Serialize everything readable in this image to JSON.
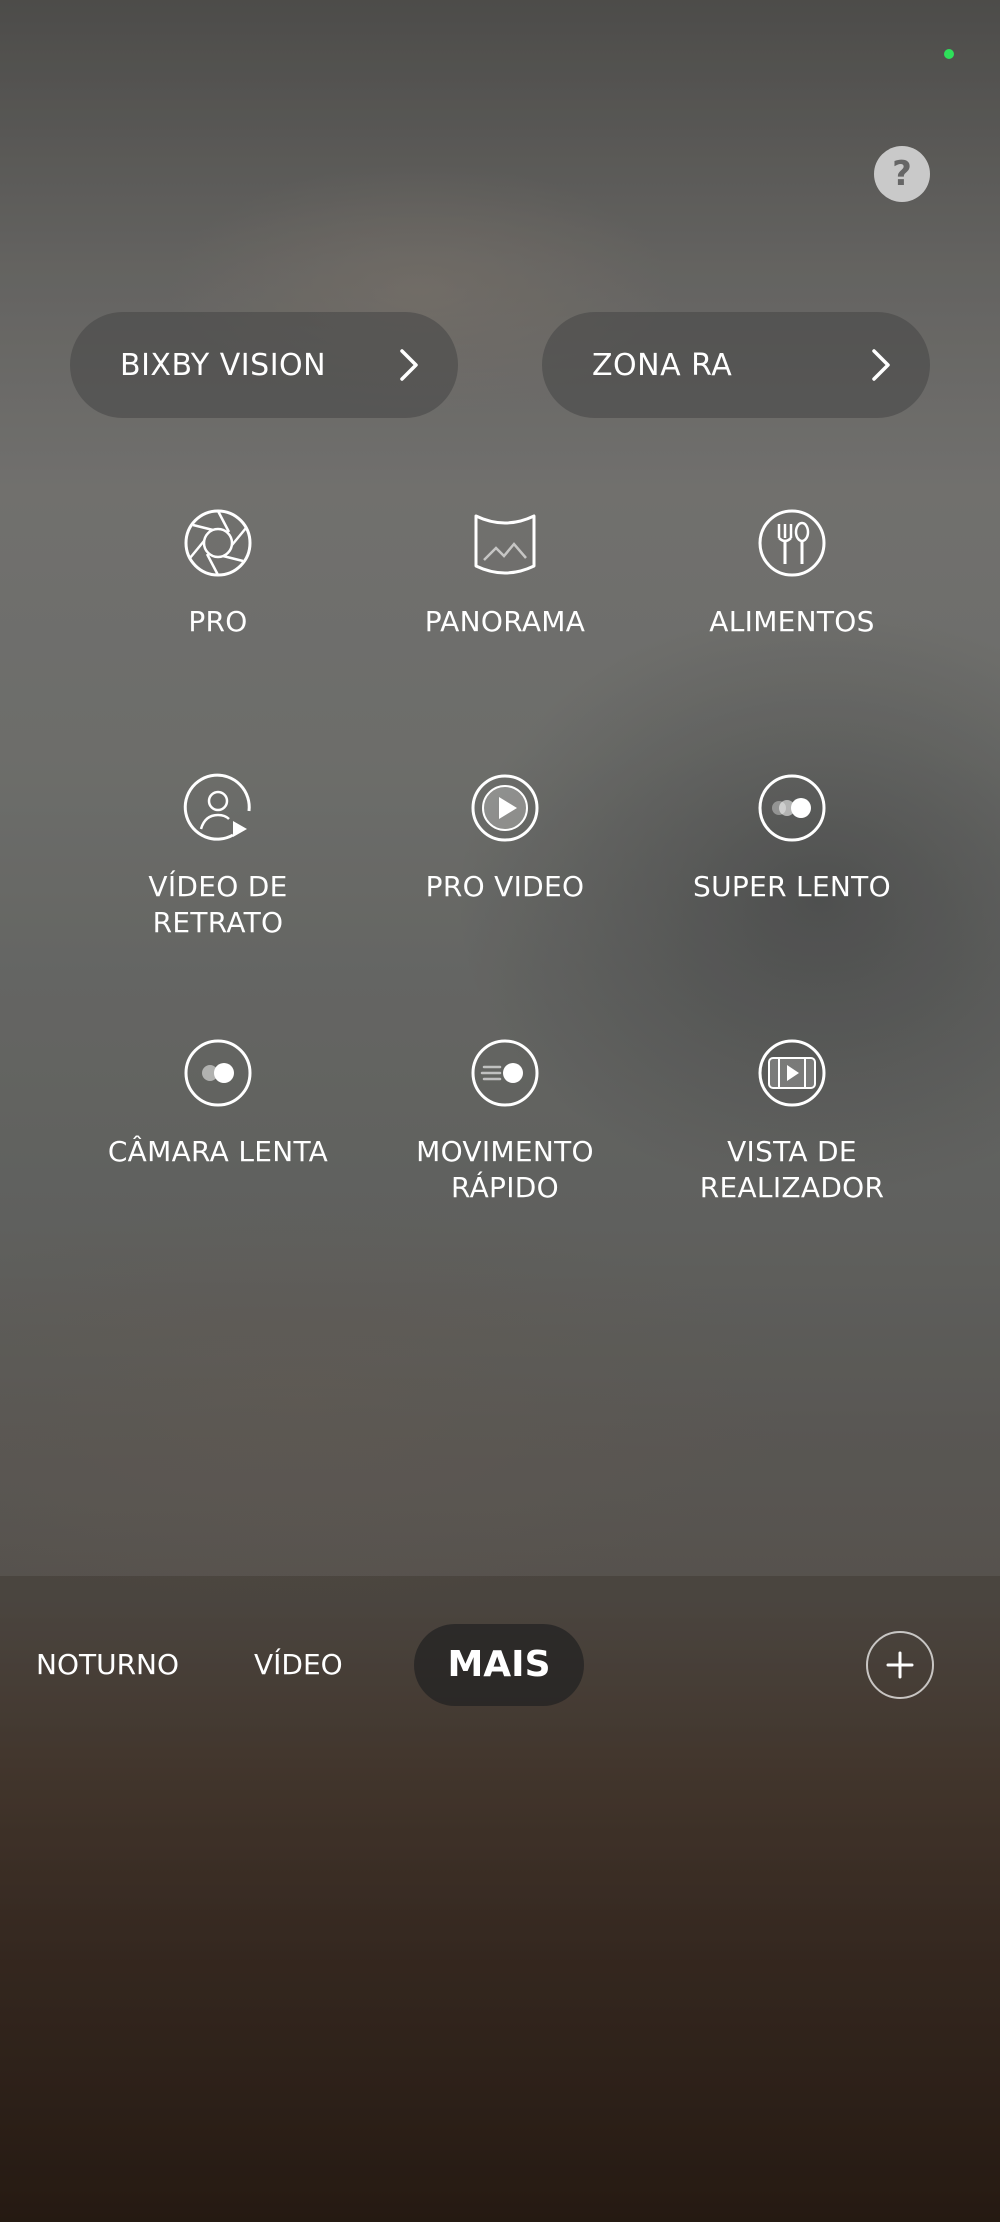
{
  "help": {
    "label": "?"
  },
  "shortcuts": [
    {
      "label": "BIXBY VISION",
      "chevron": "›"
    },
    {
      "label": "ZONA RA",
      "chevron": "›"
    }
  ],
  "modes": [
    {
      "label": "PRO",
      "icon": "aperture-icon"
    },
    {
      "label": "PANORAMA",
      "icon": "panorama-icon"
    },
    {
      "label": "ALIMENTOS",
      "icon": "fork-spoon-icon"
    },
    {
      "label": "VÍDEO DE\nRETRATO",
      "icon": "portrait-video-icon"
    },
    {
      "label": "PRO VIDEO",
      "icon": "pro-video-icon"
    },
    {
      "label": "SUPER LENTO",
      "icon": "super-slow-icon"
    },
    {
      "label": "CÂMARA LENTA",
      "icon": "slow-motion-icon"
    },
    {
      "label": "MOVIMENTO\nRÁPIDO",
      "icon": "hyperlapse-icon"
    },
    {
      "label": "VISTA DE\nREALIZADOR",
      "icon": "directors-view-icon"
    }
  ],
  "bottom_tabs": {
    "noturno": "NOTURNO",
    "video": "VÍDEO",
    "mais": "MAIS"
  },
  "add_button": {
    "icon": "plus-icon"
  },
  "colors": {
    "status_dot": "#2ee05a",
    "pill_bg": "#464646"
  }
}
